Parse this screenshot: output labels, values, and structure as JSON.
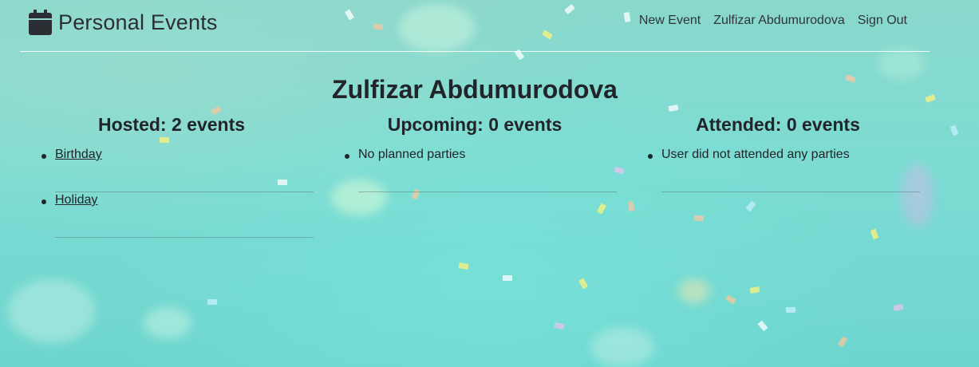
{
  "app": {
    "brand_text": "Personal Events",
    "brand_icon": "calendar-icon"
  },
  "nav": {
    "new_event": "New Event",
    "user_name": "Zulfizar Abdumurodova",
    "sign_out": "Sign Out"
  },
  "profile": {
    "name": "Zulfizar Abdumurodova"
  },
  "hosted": {
    "title": "Hosted: 2 events",
    "events": [
      "Birthday",
      "Holiday"
    ]
  },
  "upcoming": {
    "title": "Upcoming: 0 events",
    "empty_text": "No planned parties"
  },
  "attended": {
    "title": "Attended: 0 events",
    "empty_text": "User did not attended any parties"
  },
  "colors": {
    "background": "#7fd9cf",
    "text": "#212529"
  }
}
